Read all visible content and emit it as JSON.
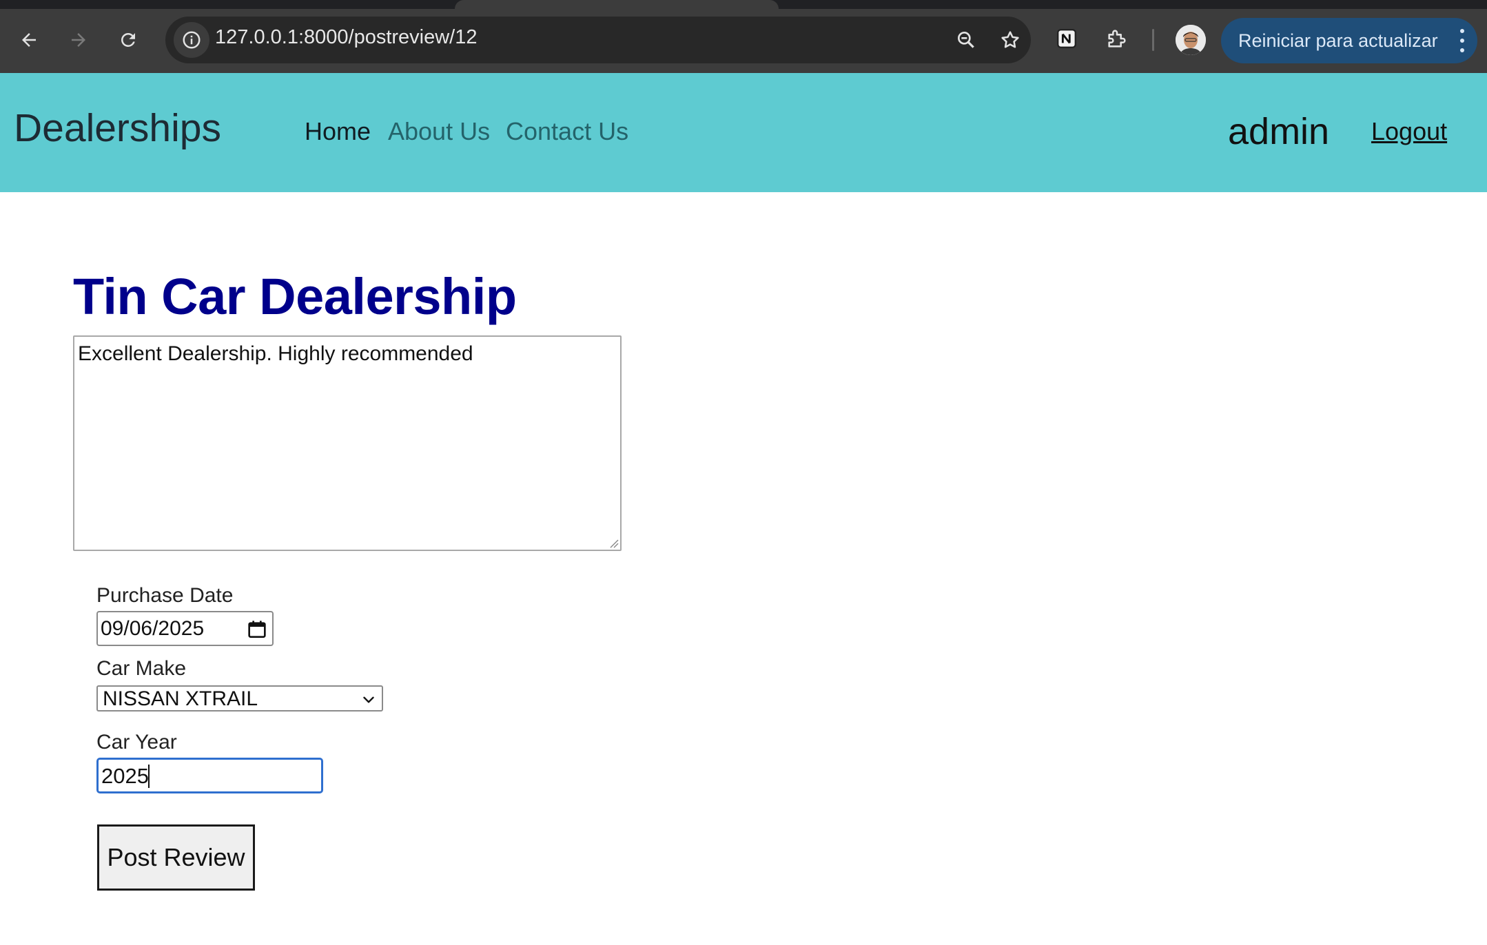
{
  "browser": {
    "url": "127.0.0.1:8000/postreview/12",
    "update_button_label": "Reiniciar para actualizar"
  },
  "navbar": {
    "brand": "Dealerships",
    "links": [
      {
        "label": "Home",
        "active": true
      },
      {
        "label": "About Us",
        "active": false
      },
      {
        "label": "Contact Us",
        "active": false
      }
    ],
    "username": "admin",
    "logout_label": "Logout",
    "background_color": "#5ecbd1"
  },
  "main": {
    "title": "Tin Car Dealership",
    "title_color": "#00008b",
    "review_text": "Excellent Dealership. Highly recommended",
    "purchase_date": {
      "label": "Purchase Date",
      "value": "09/06/2025"
    },
    "car_make": {
      "label": "Car Make",
      "selected": "NISSAN XTRAIL"
    },
    "car_year": {
      "label": "Car Year",
      "value": "2025"
    },
    "submit_label": "Post Review"
  }
}
